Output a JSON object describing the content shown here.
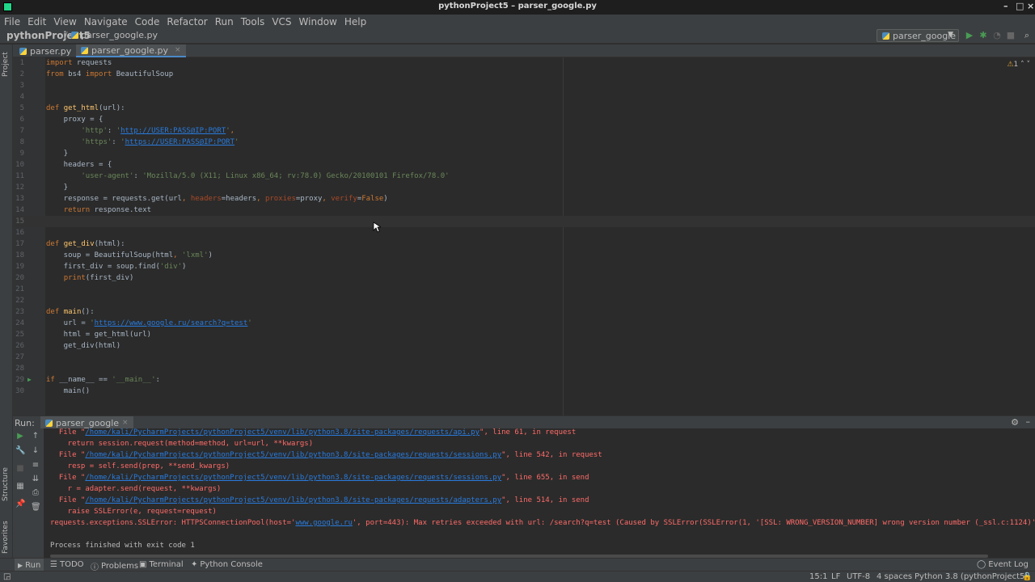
{
  "window": {
    "title": "pythonProject5 – parser_google.py"
  },
  "menu": [
    "File",
    "Edit",
    "View",
    "Navigate",
    "Code",
    "Refactor",
    "Run",
    "Tools",
    "VCS",
    "Window",
    "Help"
  ],
  "breadcrumb": {
    "project": "pythonProject5",
    "file": "parser_google.py"
  },
  "run_config": {
    "label": "parser_google"
  },
  "side_stripe": {
    "project": "Project",
    "structure": "Structure",
    "favorites": "Favorites"
  },
  "tabs": [
    {
      "label": "parser.py"
    },
    {
      "label": "parser_google.py"
    }
  ],
  "editor": {
    "warnings": "1",
    "lines": [
      {
        "n": "1"
      },
      {
        "n": "2"
      },
      {
        "n": "3"
      },
      {
        "n": "4"
      },
      {
        "n": "5"
      },
      {
        "n": "6"
      },
      {
        "n": "7"
      },
      {
        "n": "8"
      },
      {
        "n": "9"
      },
      {
        "n": "10"
      },
      {
        "n": "11"
      },
      {
        "n": "12"
      },
      {
        "n": "13"
      },
      {
        "n": "14"
      },
      {
        "n": "15"
      },
      {
        "n": "16"
      },
      {
        "n": "17"
      },
      {
        "n": "18"
      },
      {
        "n": "19"
      },
      {
        "n": "20"
      },
      {
        "n": "21"
      },
      {
        "n": "22"
      },
      {
        "n": "23"
      },
      {
        "n": "24"
      },
      {
        "n": "25"
      },
      {
        "n": "26"
      },
      {
        "n": "27"
      },
      {
        "n": "28"
      },
      {
        "n": "29"
      },
      {
        "n": "30"
      }
    ],
    "code": {
      "l1_kw": "import",
      "l1_rest": " requests",
      "l2_kw1": "from",
      "l2_mid": " bs4 ",
      "l2_kw2": "import",
      "l2_rest": " BeautifulSoup",
      "l5_kw": "def",
      "l5_fn": "get_html",
      "l5_rest": "(url):",
      "l6": "    proxy = {",
      "l7_pre": "        ",
      "l7_key": "'http'",
      "l7_colon": ": ",
      "l7_q1": "'",
      "l7_url": "http://USER:PASS@IP:PORT",
      "l7_q2": "'",
      "l7_end": ",",
      "l8_pre": "        ",
      "l8_key": "'https'",
      "l8_colon": ": ",
      "l8_q1": "'",
      "l8_url": "https://USER:PASS@IP:PORT",
      "l8_q2": "'",
      "l9": "    }",
      "l10": "    headers = {",
      "l11_pre": "        ",
      "l11_key": "'user-agent'",
      "l11_colon": ": ",
      "l11_val": "'Mozilla/5.0 (X11; Linux x86_64; rv:78.0) Gecko/20100101 Firefox/78.0'",
      "l12": "    }",
      "l13_a": "    response = requests.get(url",
      "l13_c1": ", ",
      "l13_h": "headers",
      "l13_b": "=headers",
      "l13_c2": ", ",
      "l13_p": "proxies",
      "l13_d": "=proxy",
      "l13_c3": ", ",
      "l13_v": "verify",
      "l13_e": "=",
      "l13_f": "False",
      "l13_g": ")",
      "l14_pre": "    ",
      "l14_kw": "return",
      "l14_rest": " response.text",
      "l17_kw": "def",
      "l17_fn": "get_div",
      "l17_rest": "(html):",
      "l18_a": "    soup = BeautifulSoup(html",
      "l18_c": ", ",
      "l18_s": "'lxml'",
      "l18_e": ")",
      "l19_a": "    first_div = soup.find(",
      "l19_s": "'div'",
      "l19_e": ")",
      "l20_pre": "    ",
      "l20_kw": "print",
      "l20_rest": "(first_div)",
      "l23_kw": "def",
      "l23_fn": "main",
      "l23_rest": "():",
      "l24_a": "    url = ",
      "l24_q1": "'",
      "l24_url": "https://www.google.ru/search?q=test",
      "l24_q2": "'",
      "l25": "    html = get_html(url)",
      "l26": "    get_div(html)",
      "l29_kw": "if",
      "l29_a": " __name__ == ",
      "l29_s": "'__main__'",
      "l29_e": ":",
      "l30": "    main()"
    }
  },
  "run_panel": {
    "label": "Run:",
    "tab": "parser_google",
    "console": {
      "c1_a": "  File \"",
      "c1_link": "/home/kali/PycharmProjects/pythonProject5/venv/lib/python3.8/site-packages/requests/api.py",
      "c1_b": "\", line 61, in request",
      "c2": "    return session.request(method=method, url=url, **kwargs)",
      "c3_a": "  File \"",
      "c3_link": "/home/kali/PycharmProjects/pythonProject5/venv/lib/python3.8/site-packages/requests/sessions.py",
      "c3_b": "\", line 542, in request",
      "c4": "    resp = self.send(prep, **send_kwargs)",
      "c5_a": "  File \"",
      "c5_link": "/home/kali/PycharmProjects/pythonProject5/venv/lib/python3.8/site-packages/requests/sessions.py",
      "c5_b": "\", line 655, in send",
      "c6": "    r = adapter.send(request, **kwargs)",
      "c7_a": "  File \"",
      "c7_link": "/home/kali/PycharmProjects/pythonProject5/venv/lib/python3.8/site-packages/requests/adapters.py",
      "c7_b": "\", line 514, in send",
      "c8": "    raise SSLError(e, request=request)",
      "c9_a": "requests.exceptions.SSLError: HTTPSConnectionPool(host='",
      "c9_link": "www.google.ru",
      "c9_b": "', port=443): Max retries exceeded with url: /search?q=test (Caused by SSLError(SSLError(1, '[SSL: WRONG_VERSION_NUMBER] wrong version number (_ssl.c:1124)')))",
      "c11": "Process finished with exit code 1"
    }
  },
  "bottom_tools": {
    "run": "Run",
    "todo": "TODO",
    "problems": "Problems",
    "terminal": "Terminal",
    "python_console": "Python Console",
    "event_log": "Event Log"
  },
  "status": {
    "position": "15:1",
    "line_sep": "LF",
    "encoding": "UTF-8",
    "indent": "4 spaces",
    "interpreter": "Python 3.8 (pythonProject5)"
  }
}
